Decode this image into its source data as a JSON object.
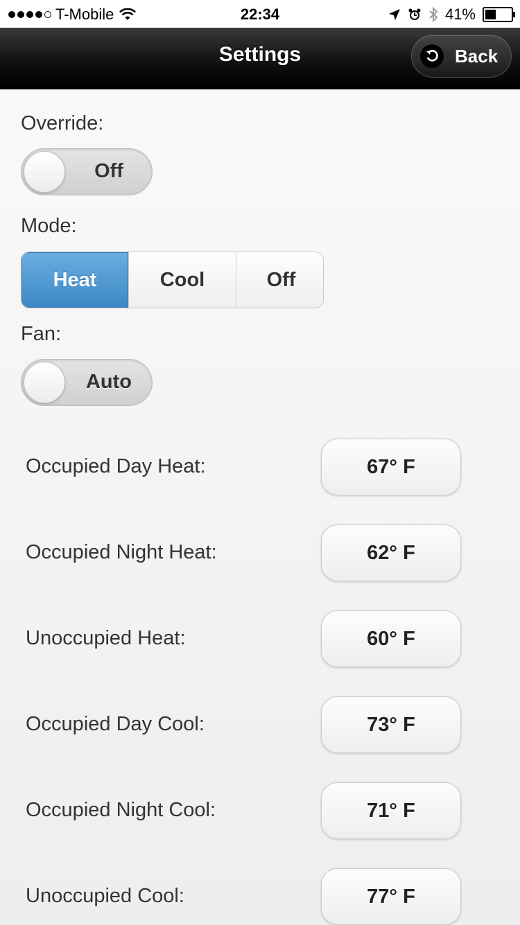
{
  "status_bar": {
    "carrier": "T-Mobile",
    "signal_bars_filled": 4,
    "signal_bars_total": 5,
    "time": "22:34",
    "battery": "41%",
    "battery_level": 0.41,
    "icons": [
      "wifi-icon",
      "location-arrow-icon",
      "alarm-icon",
      "bluetooth-icon",
      "battery-icon"
    ]
  },
  "navbar": {
    "title": "Settings",
    "back_label": "Back",
    "back_icon": "back-arrow-icon"
  },
  "settings": {
    "override": {
      "label": "Override:",
      "value": "Off"
    },
    "mode": {
      "label": "Mode:",
      "options": [
        "Heat",
        "Cool",
        "Off"
      ],
      "selected": "Heat",
      "selected_color": "#4a94d0"
    },
    "fan": {
      "label": "Fan:",
      "value": "Auto"
    },
    "temperatures": [
      {
        "label": "Occupied Day Heat:",
        "value": "67° F"
      },
      {
        "label": "Occupied Night Heat:",
        "value": "62° F"
      },
      {
        "label": "Unoccupied Heat:",
        "value": "60° F"
      },
      {
        "label": "Occupied Day Cool:",
        "value": "73° F"
      },
      {
        "label": "Occupied Night Cool:",
        "value": "71° F"
      },
      {
        "label": "Unoccupied Cool:",
        "value": "77° F"
      }
    ]
  }
}
